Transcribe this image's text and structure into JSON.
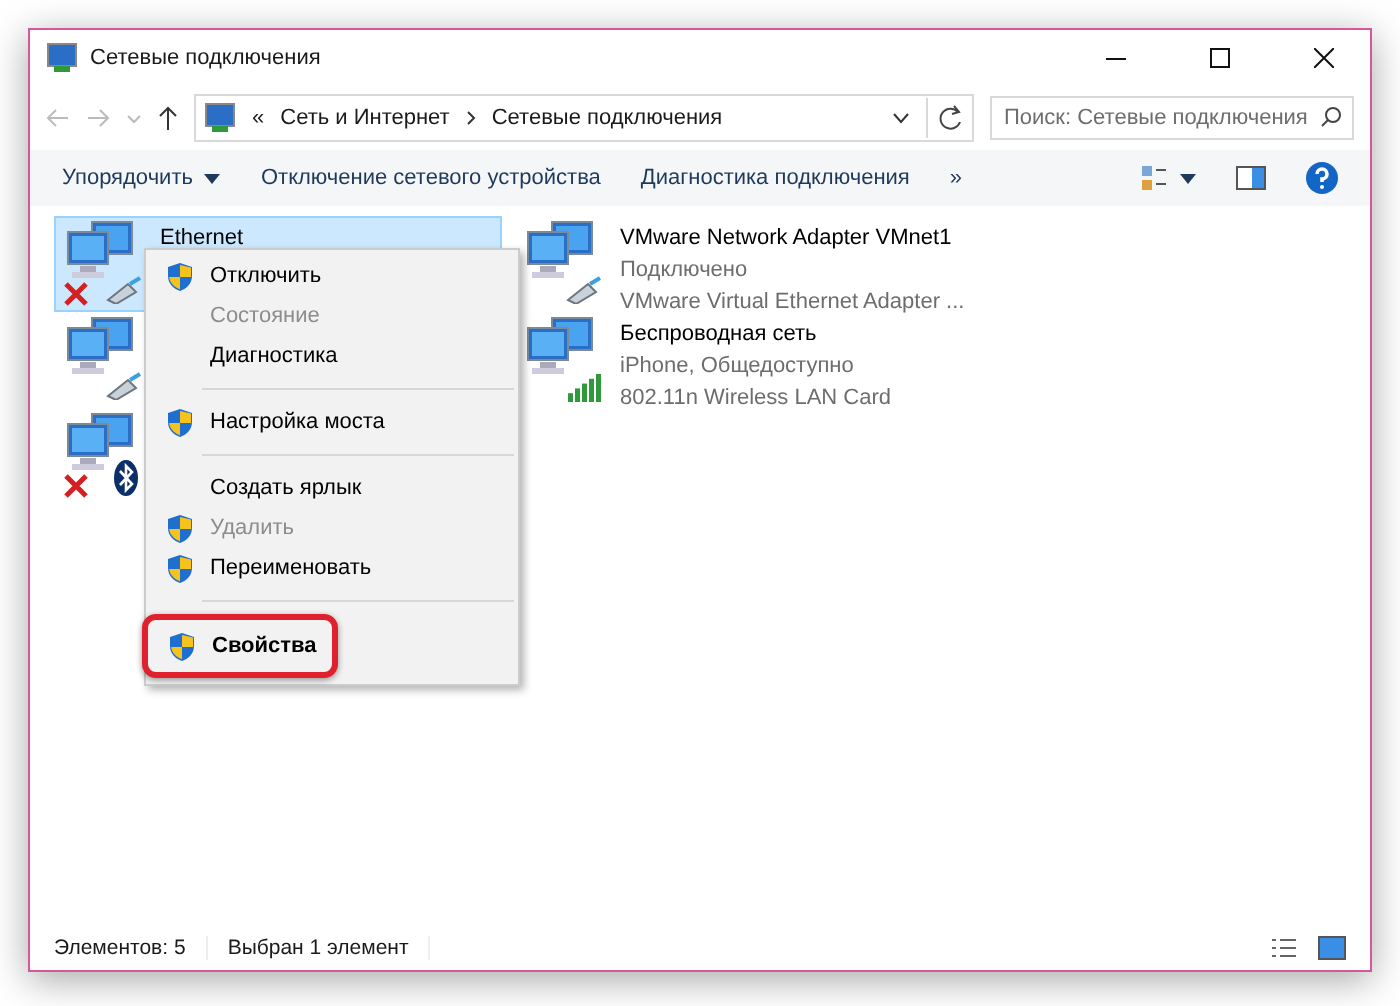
{
  "window": {
    "title": "Сетевые подключения"
  },
  "address": {
    "prefix": "«",
    "crumbs": [
      "Сеть и Интернет",
      "Сетевые подключения"
    ]
  },
  "search": {
    "placeholder": "Поиск: Сетевые подключения"
  },
  "toolbar": {
    "buttons": [
      {
        "label": "Упорядочить",
        "dropdown": true
      },
      {
        "label": "Отключение сетевого устройства",
        "dropdown": false
      },
      {
        "label": "Диагностика подключения",
        "dropdown": false
      }
    ],
    "more": "»"
  },
  "adapters": [
    {
      "name": "Ethernet",
      "kind": "cable",
      "disconnected": true,
      "selected": true
    },
    {
      "kind": "cable",
      "disconnected": false,
      "selected": false
    },
    {
      "kind": "bluetooth",
      "disconnected": true,
      "selected": false
    },
    {
      "name": "VMware Network Adapter VMnet1",
      "status": "Подключено",
      "device": "VMware Virtual Ethernet Adapter ...",
      "kind": "cable",
      "disconnected": false,
      "selected": false
    },
    {
      "name": "Беспроводная сеть",
      "status": "iPhone, Общедоступно",
      "device": "802.11n Wireless LAN Card",
      "kind": "signal",
      "disconnected": false,
      "selected": false
    }
  ],
  "context_menu": {
    "items": [
      {
        "kind": "item",
        "label": "Отключить",
        "shield": true,
        "disabled": false,
        "bold": false,
        "highlighted": false
      },
      {
        "kind": "item",
        "label": "Состояние",
        "shield": false,
        "disabled": true,
        "bold": false,
        "highlighted": false
      },
      {
        "kind": "item",
        "label": "Диагностика",
        "shield": false,
        "disabled": false,
        "bold": false,
        "highlighted": false
      },
      {
        "kind": "separator"
      },
      {
        "kind": "item",
        "label": "Настройка моста",
        "shield": true,
        "disabled": false,
        "bold": false,
        "highlighted": false
      },
      {
        "kind": "separator"
      },
      {
        "kind": "item",
        "label": "Создать ярлык",
        "shield": false,
        "disabled": false,
        "bold": false,
        "highlighted": false
      },
      {
        "kind": "item",
        "label": "Удалить",
        "shield": true,
        "disabled": true,
        "bold": false,
        "highlighted": false
      },
      {
        "kind": "item",
        "label": "Переименовать",
        "shield": true,
        "disabled": false,
        "bold": false,
        "highlighted": false
      },
      {
        "kind": "separator"
      },
      {
        "kind": "item",
        "label": "Свойства",
        "shield": true,
        "disabled": false,
        "bold": true,
        "highlighted": true
      }
    ]
  },
  "status_bar": {
    "count": "Элементов: 5",
    "selection": "Выбран 1 элемент"
  }
}
